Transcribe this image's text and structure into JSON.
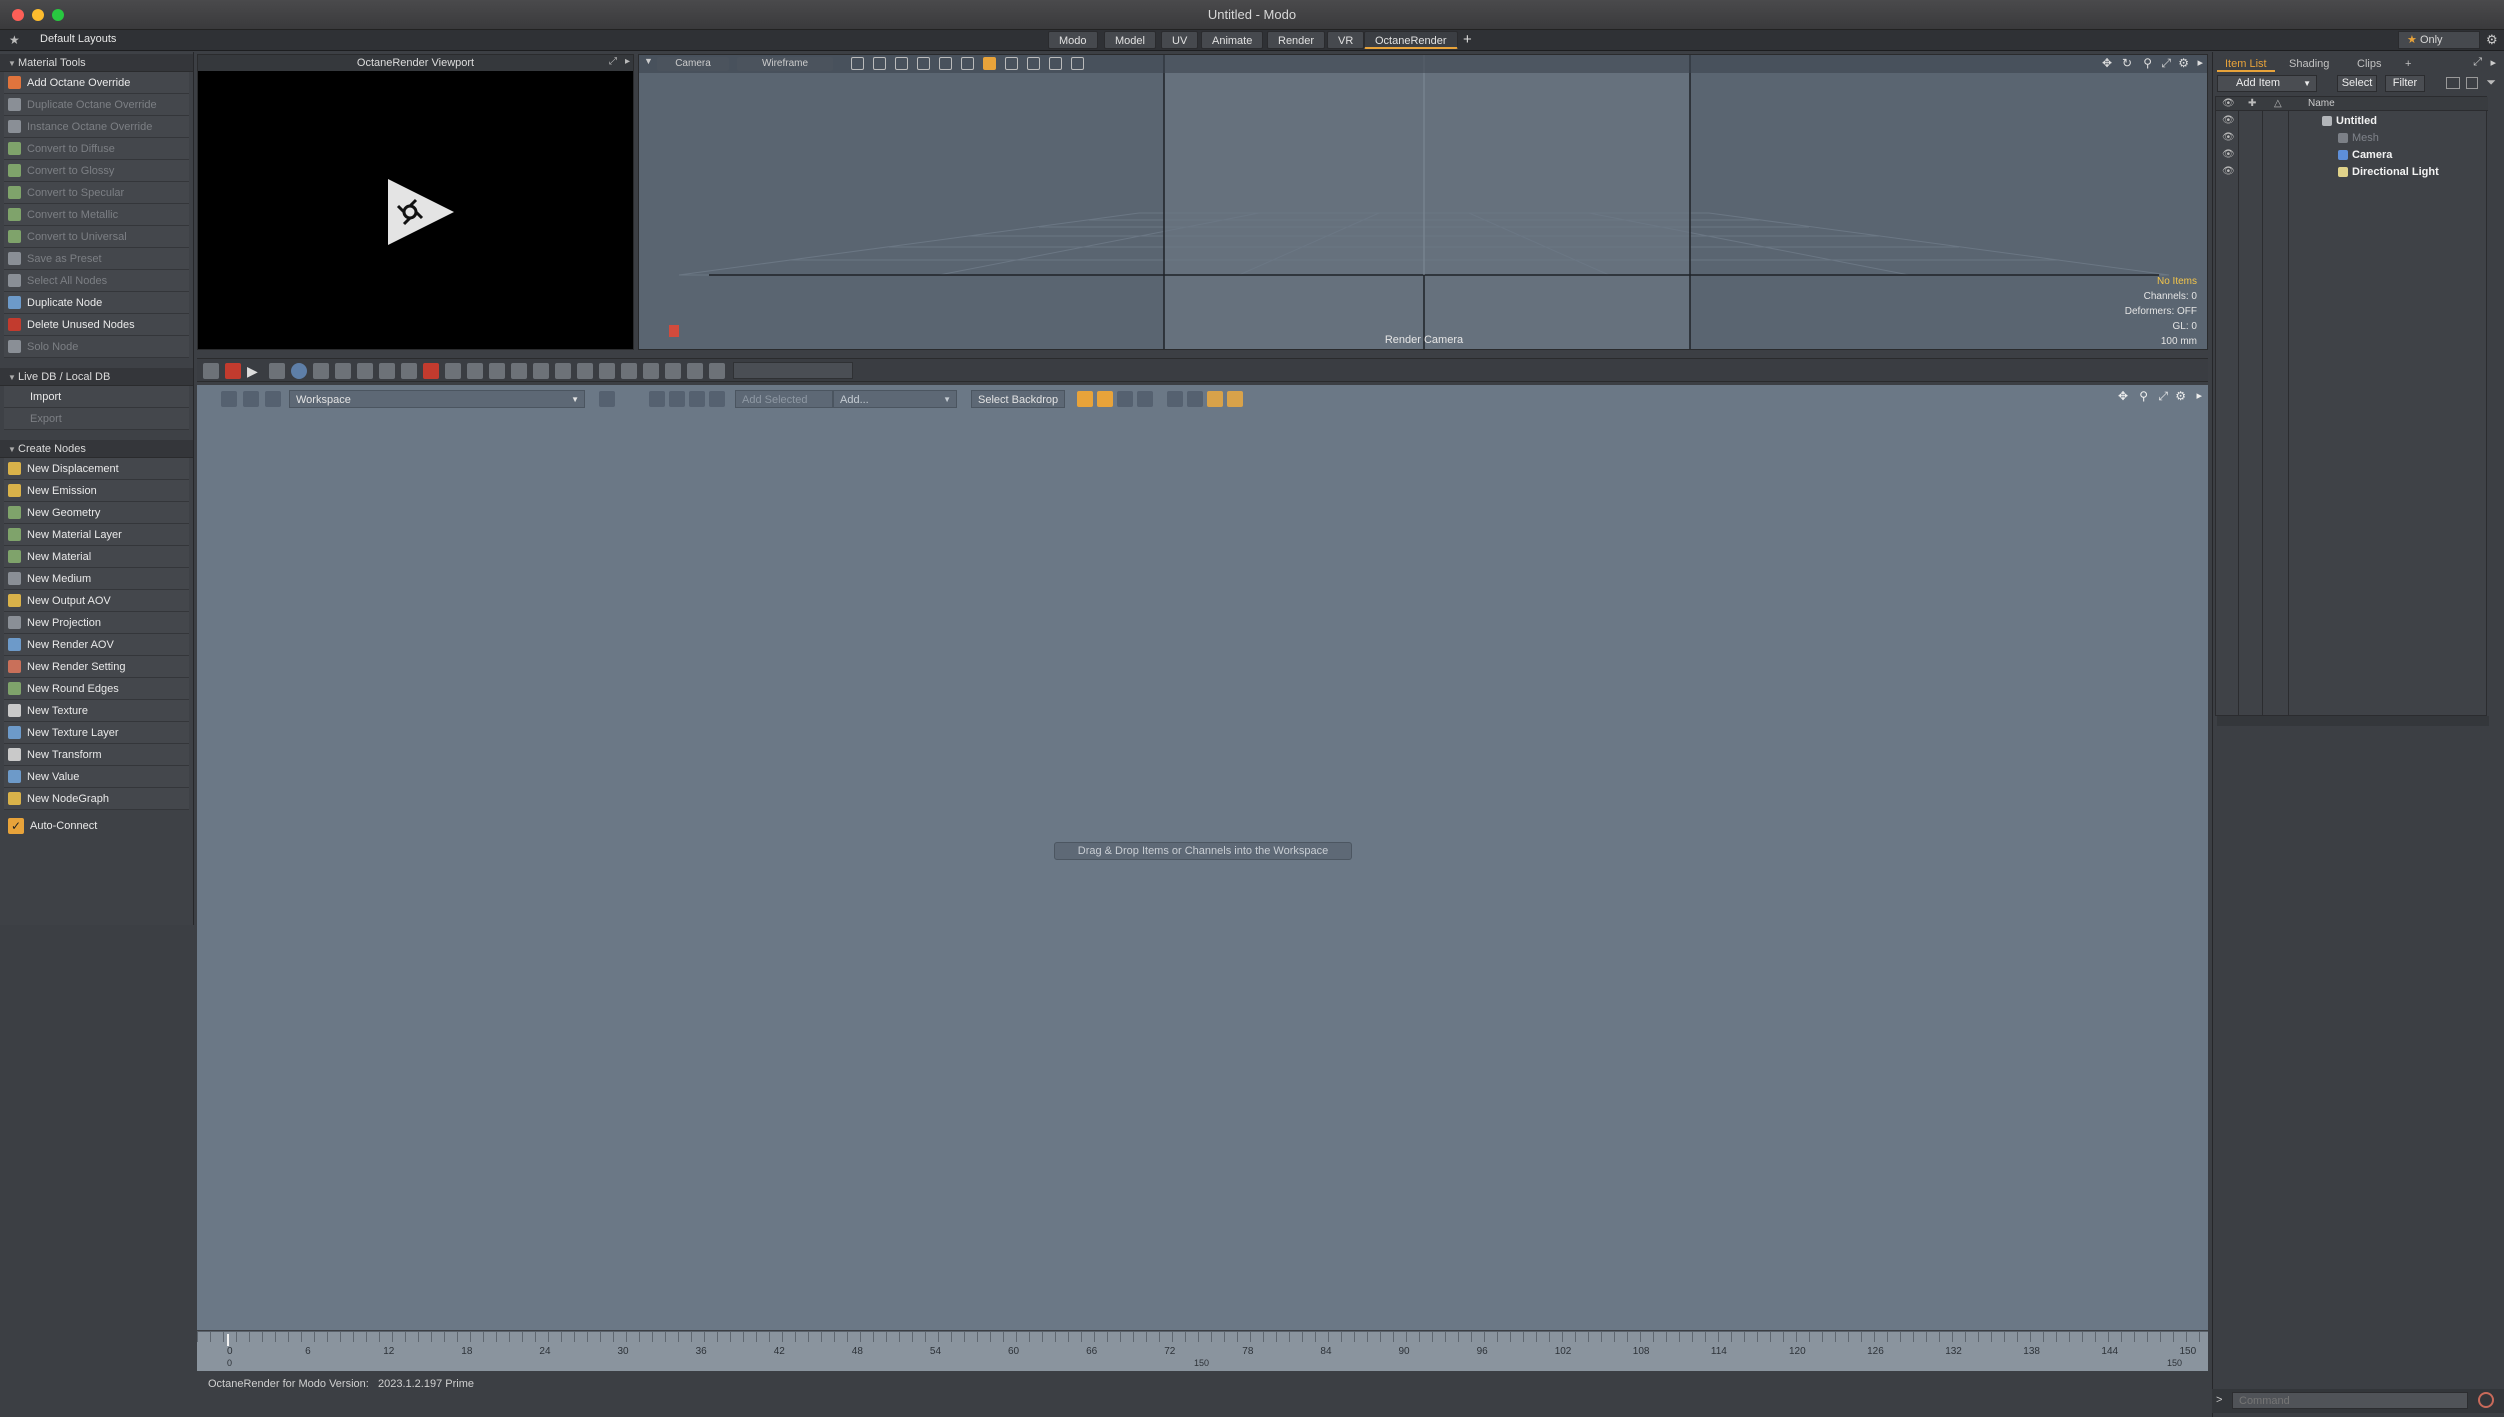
{
  "window": {
    "title": "Untitled - Modo"
  },
  "layout_bar": {
    "default_layouts": "Default Layouts",
    "tabs": [
      "Modo",
      "Model",
      "UV",
      "Animate",
      "Render",
      "VR",
      "OctaneRender"
    ],
    "active_tab": "OctaneRender",
    "add_tab": "+",
    "only_label": "Only"
  },
  "left_panel": {
    "material_tools": {
      "title": "Material Tools",
      "items": [
        {
          "label": "Add Octane Override",
          "enabled": true
        },
        {
          "label": "Duplicate Octane Override",
          "enabled": false
        },
        {
          "label": "Instance Octane Override",
          "enabled": false
        },
        {
          "label": "Convert to Diffuse",
          "enabled": false
        },
        {
          "label": "Convert to Glossy",
          "enabled": false
        },
        {
          "label": "Convert to Specular",
          "enabled": false
        },
        {
          "label": "Convert to Metallic",
          "enabled": false
        },
        {
          "label": "Convert to Universal",
          "enabled": false
        },
        {
          "label": "Save as Preset",
          "enabled": false
        },
        {
          "label": "Select All Nodes",
          "enabled": false
        },
        {
          "label": "Duplicate Node",
          "enabled": true
        },
        {
          "label": "Delete Unused Nodes",
          "enabled": true
        },
        {
          "label": "Solo Node",
          "enabled": false
        }
      ]
    },
    "live_db": {
      "title": "Live DB / Local DB",
      "items": [
        {
          "label": "Import",
          "enabled": true
        },
        {
          "label": "Export",
          "enabled": false
        }
      ]
    },
    "create_nodes": {
      "title": "Create Nodes",
      "items": [
        "New Displacement",
        "New Emission",
        "New Geometry",
        "New Material Layer",
        "New Material",
        "New Medium",
        "New Output AOV",
        "New Projection",
        "New Render AOV",
        "New Render Setting",
        "New Round Edges",
        "New Texture",
        "New Texture Layer",
        "New Transform",
        "New Value",
        "New NodeGraph"
      ]
    },
    "auto_connect": "Auto-Connect"
  },
  "octane_viewport": {
    "title": "OctaneRender Viewport"
  },
  "viewport3d": {
    "camera_btn": "Camera",
    "shading_btn": "Wireframe",
    "render_camera_label": "Render Camera",
    "info": [
      "No Items",
      "Channels: 0",
      "Deformers: OFF",
      "GL: 0",
      "100 mm"
    ]
  },
  "workspace": {
    "dropdown": "Workspace",
    "add_selected": "Add Selected",
    "add": "Add...",
    "select_backdrop": "Select Backdrop",
    "hint": "Drag & Drop Items or Channels into the Workspace"
  },
  "timeline": {
    "ticks": [
      "0",
      "6",
      "12",
      "18",
      "24",
      "30",
      "36",
      "42",
      "48",
      "54",
      "60",
      "66",
      "72",
      "78",
      "84",
      "90",
      "96",
      "102",
      "108",
      "114",
      "120",
      "126",
      "132",
      "138",
      "144",
      "150"
    ],
    "end_mid": "150",
    "end_right": "150",
    "start": "0"
  },
  "status": {
    "version_label": "OctaneRender for Modo Version:",
    "version_value": "2023.1.2.197 Prime"
  },
  "right_panel": {
    "tabs": [
      "Item List",
      "Shading",
      "Clips"
    ],
    "active_tab": "Item List",
    "add_item": "Add Item",
    "select": "Select",
    "filter": "Filter",
    "column_name": "Name",
    "items": [
      {
        "label": "Untitled",
        "level": 0,
        "bold": true
      },
      {
        "label": "Mesh",
        "level": 1,
        "bold": false
      },
      {
        "label": "Camera",
        "level": 1,
        "bold": true
      },
      {
        "label": "Directional Light",
        "level": 1,
        "bold": true
      }
    ],
    "command_placeholder": "Command",
    "prompt": ">"
  }
}
